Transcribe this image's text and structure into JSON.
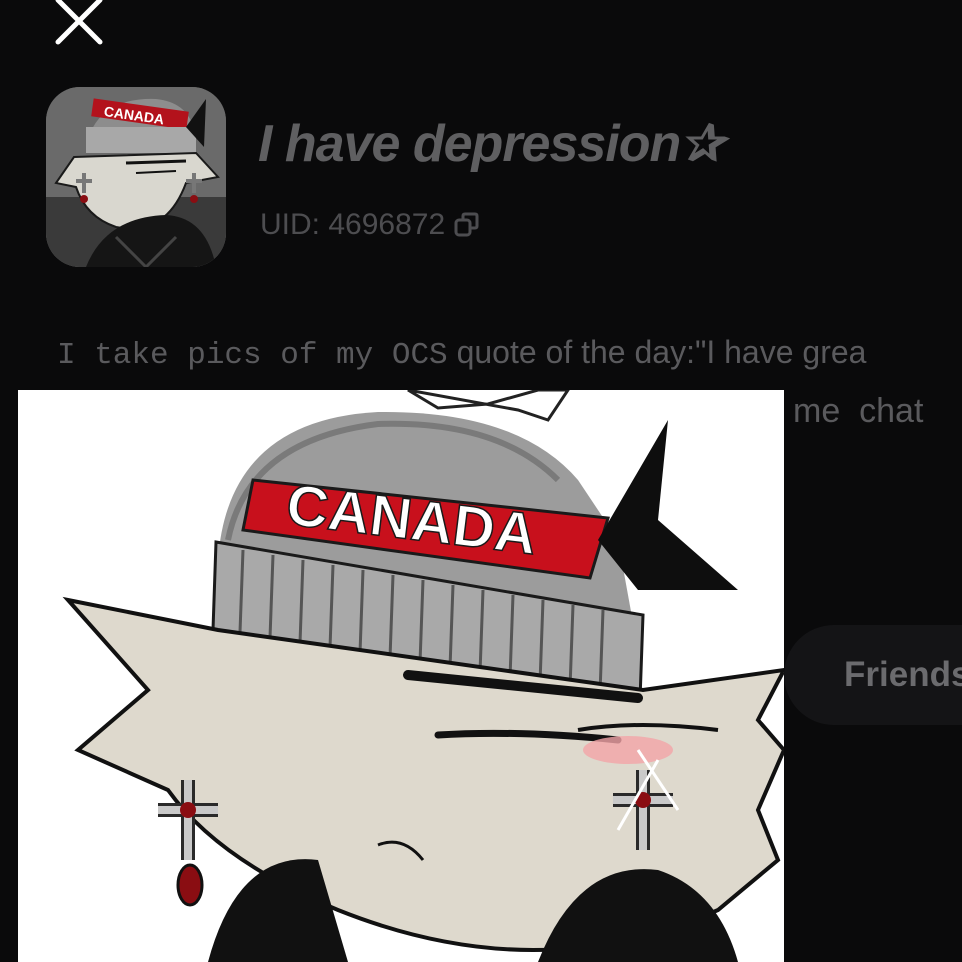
{
  "header": {
    "close_icon": "close-icon"
  },
  "profile": {
    "name": "I have depression",
    "name_star": "✰",
    "uid_label": "UID: 4696872",
    "copy_icon": "copy-icon",
    "avatar_hat_text": "CANADA"
  },
  "bio": {
    "part_mono": "I take pics of my OCS",
    "part_sans": " quote of the day:\"I have grea",
    "continuation": "me  chat"
  },
  "actions": {
    "friends_label": "Friends"
  },
  "post": {
    "hat_text": "CANADA"
  },
  "colors": {
    "background": "#0a0a0b",
    "text_muted": "#5f5f61",
    "hat_band": "#c8101c"
  }
}
